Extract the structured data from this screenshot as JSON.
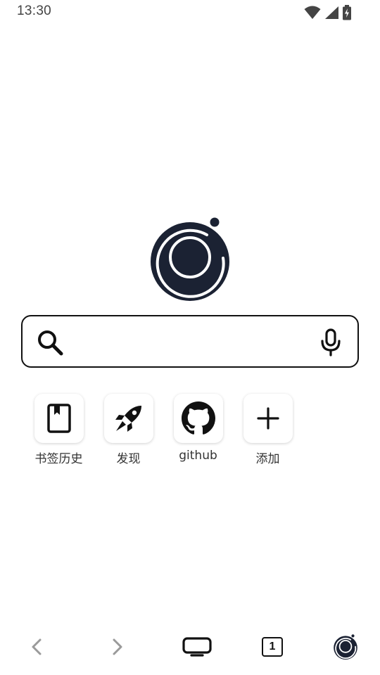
{
  "status_bar": {
    "time": "13:30",
    "icons": [
      "wifi-icon",
      "signal-icon",
      "battery-charging-icon"
    ]
  },
  "logo": {
    "icon": "browser-logo-icon"
  },
  "search": {
    "value": "",
    "placeholder": "",
    "icon": "search-icon",
    "voice_icon": "microphone-icon"
  },
  "shortcuts": [
    {
      "label": "书签历史",
      "icon": "bookmark-book-icon"
    },
    {
      "label": "发现",
      "icon": "rocket-icon"
    },
    {
      "label": "github",
      "icon": "github-icon"
    },
    {
      "label": "添加",
      "icon": "plus-icon"
    }
  ],
  "bottom_nav": {
    "tab_count": "1",
    "icons": [
      "back-arrow-icon",
      "forward-arrow-icon",
      "home-screen-icon",
      "tabs-icon",
      "menu-logo-icon"
    ]
  },
  "colors": {
    "logo_dark": "#1b2233",
    "text_dark": "#111111",
    "disabled_arrow": "#9a9a9a",
    "background": "#ffffff"
  }
}
